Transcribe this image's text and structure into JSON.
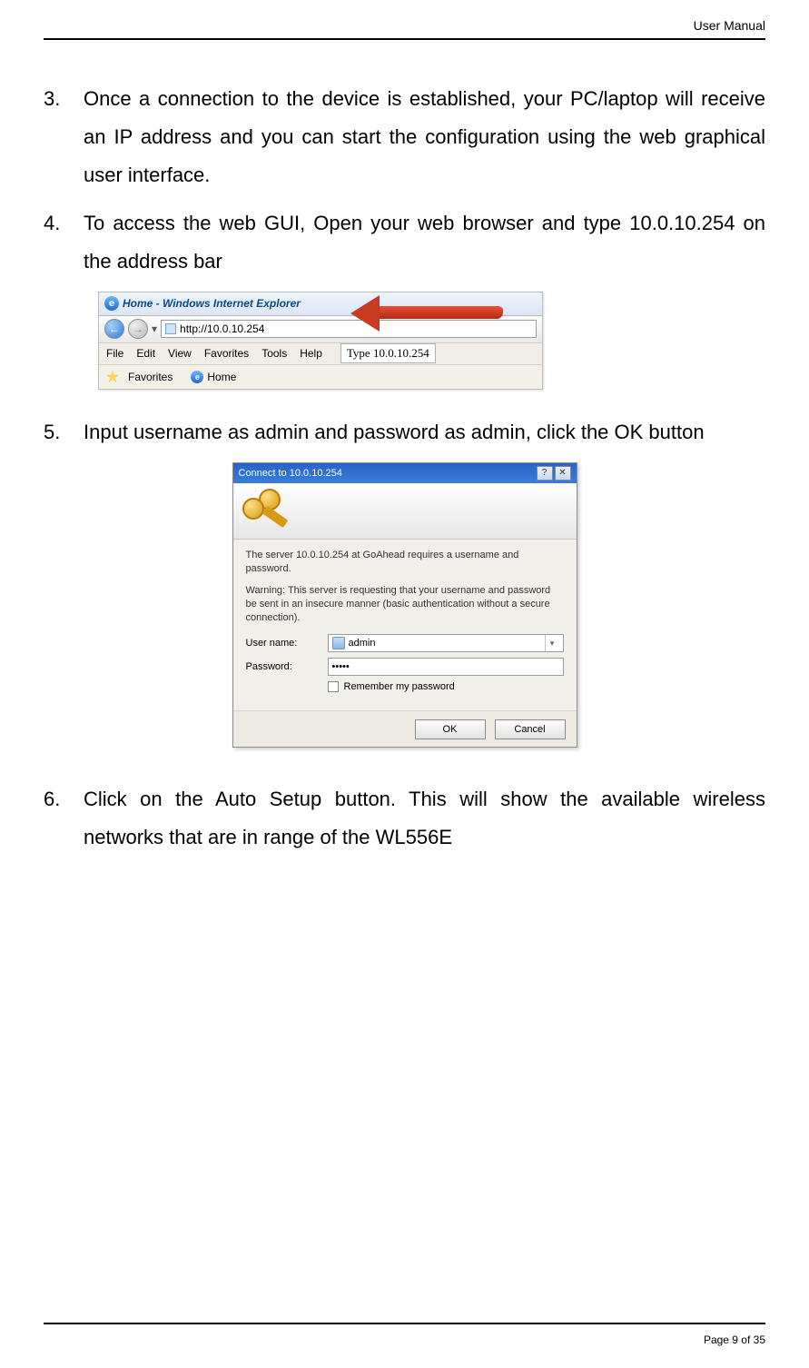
{
  "header": {
    "label": "User Manual"
  },
  "footer": {
    "label": "Page 9 of 35"
  },
  "steps": {
    "s3": {
      "num": "3.",
      "text": "Once a connection to the device is established, your PC/laptop will receive an IP address and you can start the configuration using the web graphical user interface."
    },
    "s4": {
      "num": "4.",
      "text": "To access the web GUI, Open your web browser and type 10.0.10.254 on the address bar"
    },
    "s5": {
      "num": "5.",
      "text": "Input username as admin and password as admin, click the OK button"
    },
    "s6": {
      "num": "6.",
      "text": "Click on the Auto Setup button. This will show the available wireless networks that are in range of the WL556E"
    }
  },
  "ie": {
    "title": "Home - Windows Internet Explorer",
    "url": "http://10.0.10.254",
    "menu": {
      "file": "File",
      "edit": "Edit",
      "view": "View",
      "favorites": "Favorites",
      "tools": "Tools",
      "help": "Help"
    },
    "callout": "Type 10.0.10.254",
    "fav_label": "Favorites",
    "tab_label": "Home"
  },
  "dlg": {
    "title": "Connect to 10.0.10.254",
    "msg1": "The server 10.0.10.254 at GoAhead requires a username and password.",
    "msg2": "Warning: This server is requesting that your username and password be sent in an insecure manner (basic authentication without a secure connection).",
    "user_label": "User name:",
    "user_value": "admin",
    "pass_label": "Password:",
    "pass_value": "•••••",
    "remember": "Remember my password",
    "ok": "OK",
    "cancel": "Cancel"
  }
}
